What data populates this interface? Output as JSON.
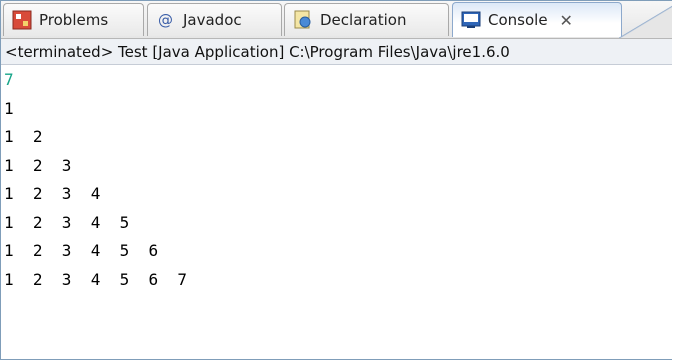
{
  "tabs": [
    {
      "label": "Problems",
      "icon": "problems-icon"
    },
    {
      "label": "Javadoc",
      "icon": "javadoc-icon"
    },
    {
      "label": "Declaration",
      "icon": "declaration-icon"
    },
    {
      "label": "Console",
      "icon": "console-icon",
      "active": true
    }
  ],
  "status": {
    "text": "<terminated> Test [Java Application] C:\\Program Files\\Java\\jre1.6.0"
  },
  "console": {
    "lines": [
      {
        "text": "7",
        "kind": "input"
      },
      {
        "text": "1",
        "kind": "output"
      },
      {
        "text": "1  2",
        "kind": "output"
      },
      {
        "text": "1  2  3",
        "kind": "output"
      },
      {
        "text": "1  2  3  4",
        "kind": "output"
      },
      {
        "text": "1  2  3  4  5",
        "kind": "output"
      },
      {
        "text": "1  2  3  4  5  6",
        "kind": "output"
      },
      {
        "text": "1  2  3  4  5  6  7",
        "kind": "output"
      }
    ]
  },
  "colors": {
    "input_text": "#17a589",
    "output_text": "#000000",
    "active_tab_border": "#8da9cc"
  }
}
